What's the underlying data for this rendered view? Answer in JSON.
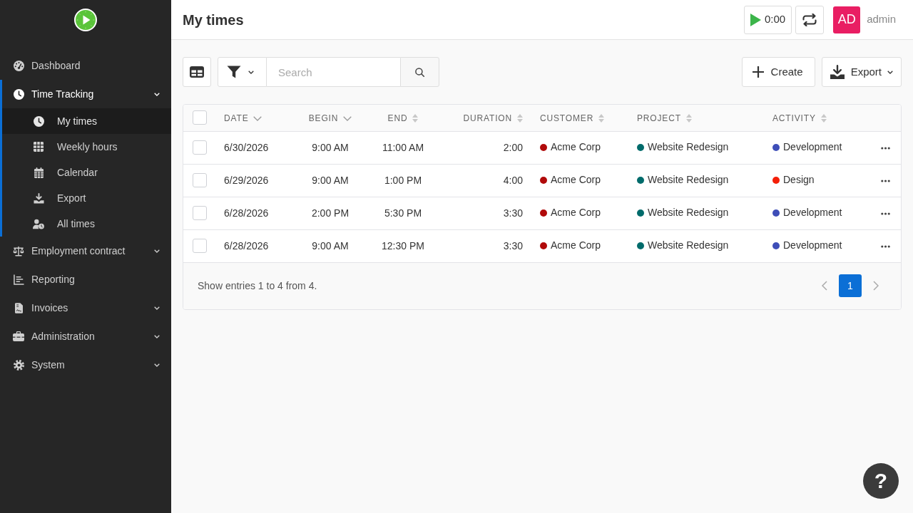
{
  "sidebar": {
    "items": [
      {
        "label": "Dashboard",
        "kind": "link"
      },
      {
        "label": "Time Tracking",
        "kind": "group",
        "expanded": true,
        "children": [
          {
            "label": "My times",
            "selected": true
          },
          {
            "label": "Weekly hours",
            "selected": false
          },
          {
            "label": "Calendar",
            "selected": false
          },
          {
            "label": "Export",
            "selected": false
          },
          {
            "label": "All times",
            "selected": false
          }
        ]
      },
      {
        "label": "Employment contract",
        "kind": "group",
        "expanded": false
      },
      {
        "label": "Reporting",
        "kind": "link"
      },
      {
        "label": "Invoices",
        "kind": "group",
        "expanded": false
      },
      {
        "label": "Administration",
        "kind": "group",
        "expanded": false
      },
      {
        "label": "System",
        "kind": "group",
        "expanded": false
      }
    ]
  },
  "header": {
    "title": "My times",
    "timer": {
      "label": "0:00"
    },
    "user": {
      "initials": "AD",
      "name": "admin"
    }
  },
  "toolbar": {
    "search": {
      "placeholder": "Search"
    },
    "actions": [
      {
        "label": "Create",
        "kind": "button"
      },
      {
        "label": "Export",
        "kind": "dropdown"
      }
    ]
  },
  "table": {
    "header_checkbox": {
      "checked": false
    },
    "columns": [
      {
        "label": "DATE",
        "sorted": true
      },
      {
        "label": "BEGIN",
        "sorted": true
      },
      {
        "label": "END",
        "sorted": false
      },
      {
        "label": "DURATION",
        "sorted": false
      },
      {
        "label": "CUSTOMER",
        "sorted": false
      },
      {
        "label": "PROJECT",
        "sorted": false
      },
      {
        "label": "ACTIVITY",
        "sorted": false
      }
    ],
    "rows": [
      {
        "checked": false,
        "date": "6/30/2026",
        "begin": "9:00 AM",
        "end": "11:00 AM",
        "duration": "2:00",
        "customer": {
          "name": "Acme Corp",
          "color": "#b00a0a"
        },
        "project": {
          "name": "Website Redesign",
          "color": "#006b6b"
        },
        "activity": {
          "name": "Development",
          "color": "#3e4eb8"
        }
      },
      {
        "checked": false,
        "date": "6/29/2026",
        "begin": "9:00 AM",
        "end": "1:00 PM",
        "duration": "4:00",
        "customer": {
          "name": "Acme Corp",
          "color": "#b00a0a"
        },
        "project": {
          "name": "Website Redesign",
          "color": "#006b6b"
        },
        "activity": {
          "name": "Design",
          "color": "#f41f08"
        }
      },
      {
        "checked": false,
        "date": "6/28/2026",
        "begin": "2:00 PM",
        "end": "5:30 PM",
        "duration": "3:30",
        "customer": {
          "name": "Acme Corp",
          "color": "#b00a0a"
        },
        "project": {
          "name": "Website Redesign",
          "color": "#006b6b"
        },
        "activity": {
          "name": "Development",
          "color": "#3e4eb8"
        }
      },
      {
        "checked": false,
        "date": "6/28/2026",
        "begin": "9:00 AM",
        "end": "12:30 PM",
        "duration": "3:30",
        "customer": {
          "name": "Acme Corp",
          "color": "#b00a0a"
        },
        "project": {
          "name": "Website Redesign",
          "color": "#006b6b"
        },
        "activity": {
          "name": "Development",
          "color": "#3e4eb8"
        }
      }
    ]
  },
  "footer": {
    "summary": "Show entries 1 to 4 from 4.",
    "pages": [
      {
        "label": "1",
        "selected": true
      }
    ]
  },
  "help_button": {
    "label": "?"
  }
}
